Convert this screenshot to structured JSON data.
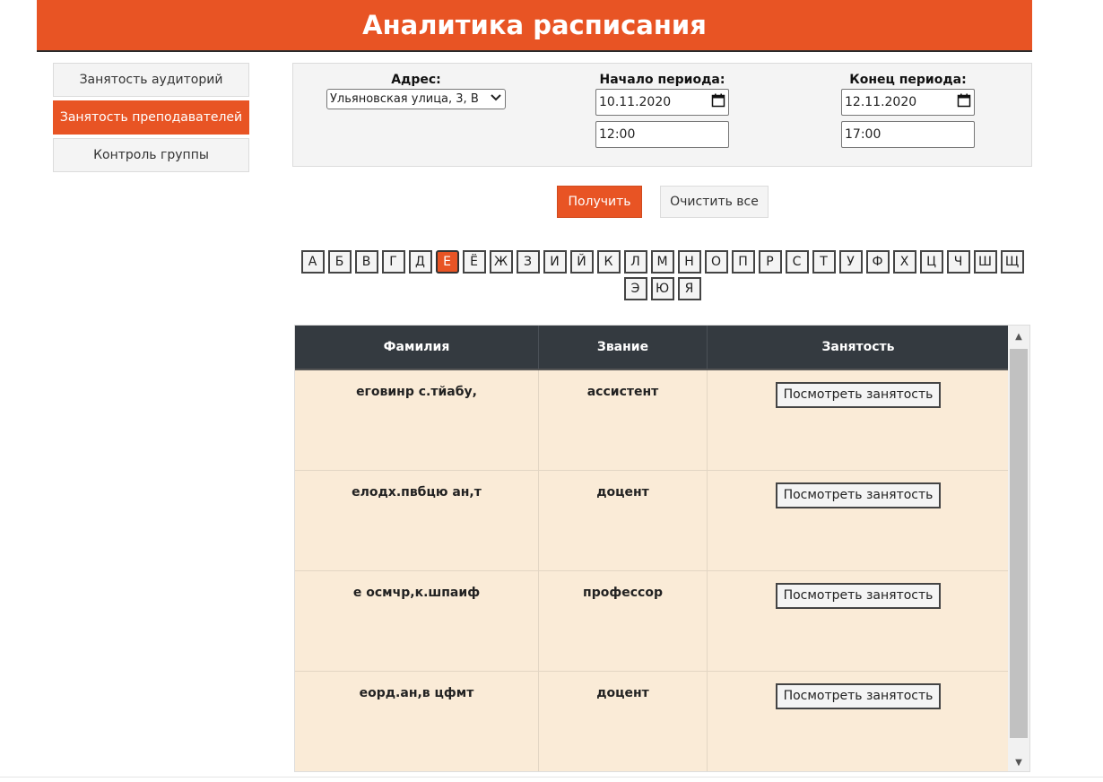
{
  "header": {
    "title": "Аналитика расписания"
  },
  "sidebar": {
    "items": [
      {
        "label": "Занятость аудиторий",
        "active": false
      },
      {
        "label": "Занятость преподавателей",
        "active": true
      },
      {
        "label": "Контроль группы",
        "active": false
      }
    ]
  },
  "filters": {
    "address": {
      "label": "Адрес:",
      "value": "Ульяновская улица, 3, В"
    },
    "start": {
      "label": "Начало периода:",
      "date": "10.11.2020",
      "time": "12:00"
    },
    "end": {
      "label": "Конец периода:",
      "date": "12.11.2020",
      "time": "17:00"
    }
  },
  "actions": {
    "get_label": "Получить",
    "clear_label": "Очистить все"
  },
  "alphabet": {
    "letters": [
      "А",
      "Б",
      "В",
      "Г",
      "Д",
      "Е",
      "Ё",
      "Ж",
      "З",
      "И",
      "Й",
      "К",
      "Л",
      "М",
      "Н",
      "О",
      "П",
      "Р",
      "С",
      "Т",
      "У",
      "Ф",
      "Х",
      "Ц",
      "Ч",
      "Ш",
      "Щ",
      "Э",
      "Ю",
      "Я"
    ],
    "selected": "Е"
  },
  "table": {
    "headers": [
      "Фамилия",
      "Звание",
      "Занятость"
    ],
    "rows": [
      {
        "name": "еговинр с.тйабу,",
        "rank": "ассистент",
        "action": "Посмотреть занятость"
      },
      {
        "name": "елодх.пвбцю ан,т",
        "rank": "доцент",
        "action": "Посмотреть занятость"
      },
      {
        "name": "е осмчр,к.шпаиф",
        "rank": "профессор",
        "action": "Посмотреть занятость"
      },
      {
        "name": "еорд.ан,в цфмт",
        "rank": "доцент",
        "action": "Посмотреть занятость"
      }
    ]
  },
  "colors": {
    "accent": "#e85424",
    "table_header": "#343a40",
    "row_bg": "#faebd7"
  }
}
